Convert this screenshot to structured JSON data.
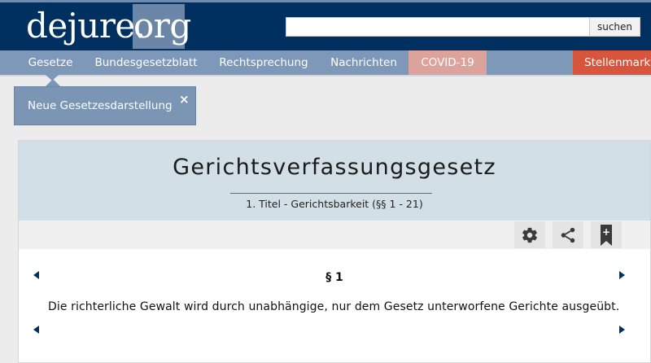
{
  "header": {
    "logo_main": "dejure.",
    "logo_tld": "org",
    "search_button": "suchen",
    "search_value": ""
  },
  "nav": {
    "items": [
      {
        "label": "Gesetze"
      },
      {
        "label": "Bundesgesetzblatt"
      },
      {
        "label": "Rechtsprechung"
      },
      {
        "label": "Nachrichten"
      },
      {
        "label": "COVID-19"
      },
      {
        "label": "Stellenmarkt"
      }
    ]
  },
  "popup": {
    "text": "Neue Gesetzesdarstellung",
    "close": "×"
  },
  "law": {
    "title": "Gerichtsverfassungsgesetz",
    "subtitle": "1. Titel - Gerichtsbarkeit (§§ 1 - 21)"
  },
  "toolbar": {
    "icons": [
      "gear-icon",
      "share-icon",
      "bookmark-add-icon"
    ],
    "bookmark_plus": "+"
  },
  "paragraph": {
    "number": "§ 1",
    "text": "Die richterliche Gewalt wird durch unabhängige, nur dem Gesetz unterworfene Gerichte ausgeübt."
  },
  "colors": {
    "header_bg": "#00305f",
    "nav_bg": "#7d98b8",
    "covid_bg": "#dca29c",
    "jobs_bg": "#d8553d",
    "card_head_bg": "#d3dfe7"
  }
}
